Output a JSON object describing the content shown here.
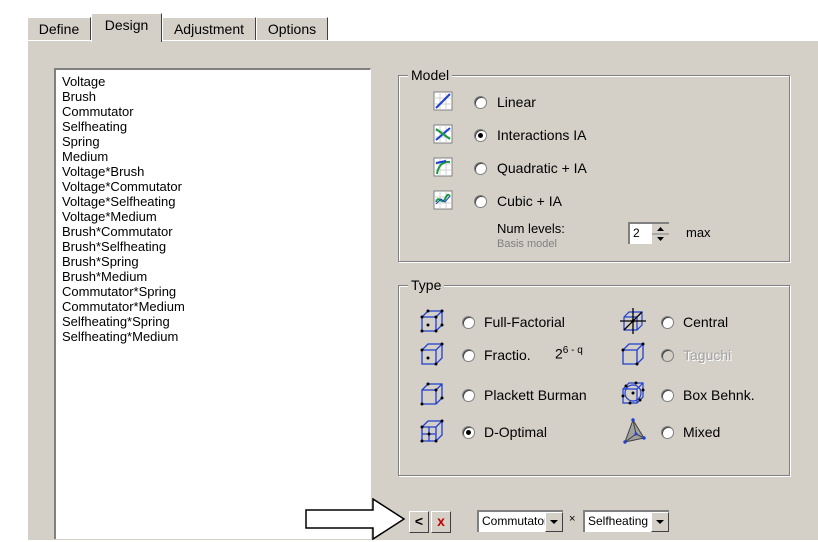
{
  "tabs": [
    "Define",
    "Design",
    "Adjustment",
    "Options"
  ],
  "active_tab": "Design",
  "terms": [
    "Voltage",
    "Brush",
    "Commutator",
    "Selfheating",
    "Spring",
    "Medium",
    "Voltage*Brush",
    "Voltage*Commutator",
    "Voltage*Selfheating",
    "Voltage*Medium",
    "Brush*Commutator",
    "Brush*Selfheating",
    "Brush*Spring",
    "Brush*Medium",
    "Commutator*Spring",
    "Commutator*Medium",
    "Selfheating*Spring",
    "Selfheating*Medium"
  ],
  "model": {
    "legend": "Model",
    "options": [
      {
        "label": "Linear",
        "checked": false,
        "icon": "linear-model-icon"
      },
      {
        "label": "Interactions IA",
        "checked": true,
        "icon": "interactions-model-icon"
      },
      {
        "label": "Quadratic + IA",
        "checked": false,
        "icon": "quadratic-model-icon"
      },
      {
        "label": "Cubic + IA",
        "checked": false,
        "icon": "cubic-model-icon"
      }
    ],
    "num_levels_label": "Num levels:",
    "basis_label": "Basis model",
    "num_levels_value": "2",
    "max_label": "max"
  },
  "type": {
    "legend": "Type",
    "options": [
      {
        "label": "Full-Factorial",
        "checked": false,
        "disabled": false,
        "icon": "full-factorial-cube-icon"
      },
      {
        "label": "Central",
        "checked": false,
        "disabled": false,
        "icon": "central-composite-cube-icon"
      },
      {
        "label": "Fractio.",
        "suffix_base": "2",
        "suffix_exp": "6 - q",
        "checked": false,
        "disabled": false,
        "icon": "fractional-cube-icon"
      },
      {
        "label": "Taguchi",
        "checked": false,
        "disabled": true,
        "icon": "taguchi-cube-icon"
      },
      {
        "label": "Plackett Burman",
        "checked": false,
        "disabled": false,
        "icon": "plackett-burman-cube-icon"
      },
      {
        "label": "Box Behnk.",
        "checked": false,
        "disabled": false,
        "icon": "box-behnken-cube-icon"
      },
      {
        "label": "D-Optimal",
        "checked": true,
        "disabled": false,
        "icon": "d-optimal-cube-icon"
      },
      {
        "label": "Mixed",
        "checked": false,
        "disabled": false,
        "icon": "mixed-simplex-icon"
      }
    ]
  },
  "builder": {
    "back_symbol": "<",
    "delete_symbol": "x",
    "factor1": "Commutator",
    "times_symbol": "×",
    "factor2": "Selfheating"
  },
  "colors": {
    "panel": "#d4d0c8",
    "delete_red": "#c00000",
    "icon_blue": "#1f3fd0",
    "icon_green": "#1a9a40"
  }
}
